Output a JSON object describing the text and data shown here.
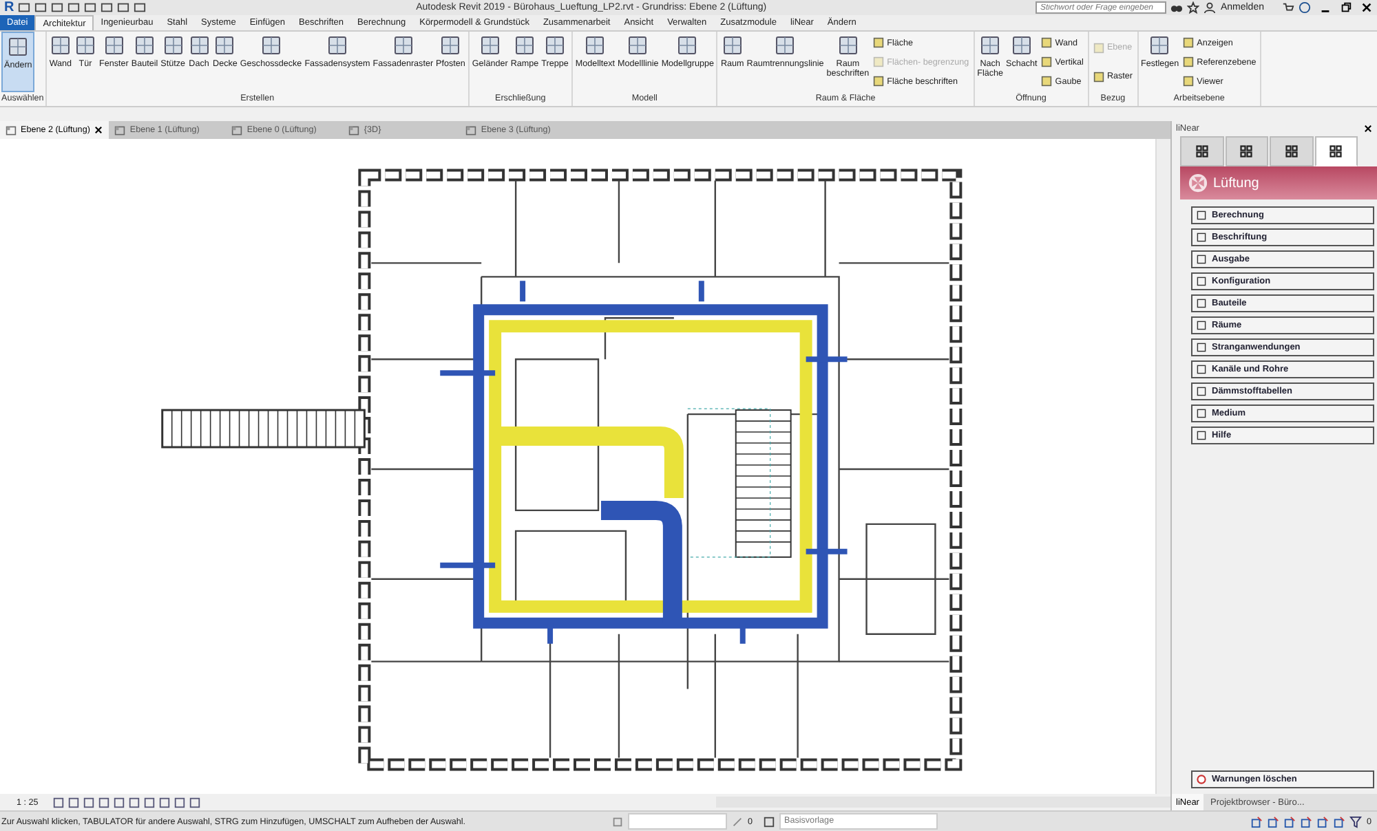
{
  "title_bar": {
    "logo": "R",
    "title": "Autodesk Revit 2019 - Bürohaus_Lueftung_LP2.rvt - Grundriss: Ebene 2 (Lüftung)",
    "search": {
      "placeholder": "Stichwort oder Frage eingeben"
    },
    "user": "Anmelden"
  },
  "menu_tabs": [
    {
      "label": "Datei",
      "kind": "file",
      "selected": false
    },
    {
      "label": "Architektur",
      "kind": "tab",
      "selected": true
    },
    {
      "label": "Ingenieurbau",
      "kind": "tab",
      "selected": false
    },
    {
      "label": "Stahl",
      "kind": "tab",
      "selected": false
    },
    {
      "label": "Systeme",
      "kind": "tab",
      "selected": false
    },
    {
      "label": "Einfügen",
      "kind": "tab",
      "selected": false
    },
    {
      "label": "Beschriften",
      "kind": "tab",
      "selected": false
    },
    {
      "label": "Berechnung",
      "kind": "tab",
      "selected": false
    },
    {
      "label": "Körpermodell & Grundstück",
      "kind": "tab",
      "selected": false
    },
    {
      "label": "Zusammenarbeit",
      "kind": "tab",
      "selected": false
    },
    {
      "label": "Ansicht",
      "kind": "tab",
      "selected": false
    },
    {
      "label": "Verwalten",
      "kind": "tab",
      "selected": false
    },
    {
      "label": "Zusatzmodule",
      "kind": "tab",
      "selected": false
    },
    {
      "label": "liNear",
      "kind": "tab",
      "selected": false
    },
    {
      "label": "Ändern",
      "kind": "tab",
      "selected": false
    }
  ],
  "ribbon_groups": [
    {
      "title": "Auswählen",
      "large": [
        {
          "label": "Ändern",
          "selected": true
        }
      ]
    },
    {
      "title": "Erstellen",
      "large": [
        {
          "label": "Wand",
          "selected": false
        },
        {
          "label": "Tür",
          "selected": false
        },
        {
          "label": "Fenster",
          "selected": false
        },
        {
          "label": "Bauteil",
          "selected": false
        },
        {
          "label": "Stütze",
          "selected": false
        },
        {
          "label": "Dach",
          "selected": false
        },
        {
          "label": "Decke",
          "selected": false
        },
        {
          "label": "Geschossdecke",
          "selected": false
        },
        {
          "label": "Fassadensystem",
          "selected": false
        },
        {
          "label": "Fassadenraster",
          "selected": false
        },
        {
          "label": "Pfosten",
          "selected": false
        }
      ]
    },
    {
      "title": "Erschließung",
      "large": [
        {
          "label": "Geländer",
          "selected": false
        },
        {
          "label": "Rampe",
          "selected": false
        },
        {
          "label": "Treppe",
          "selected": false
        }
      ]
    },
    {
      "title": "Modell",
      "large": [
        {
          "label": "Modelltext",
          "selected": false
        },
        {
          "label": "Modelllinie",
          "selected": false
        },
        {
          "label": "Modellgruppe",
          "selected": false
        }
      ]
    },
    {
      "title": "Raum & Fläche",
      "large": [
        {
          "label": "Raum",
          "selected": false
        },
        {
          "label": "Raumtrennungslinie",
          "selected": false
        },
        {
          "label": "Raum\nbeschriften",
          "selected": false
        }
      ],
      "small": [
        {
          "label": "Fläche",
          "disabled": false
        },
        {
          "label": "Flächen- begrenzung",
          "disabled": true
        },
        {
          "label": "Fläche beschriften",
          "disabled": false
        }
      ]
    },
    {
      "title": "Öffnung",
      "large": [
        {
          "label": "Nach\nFläche",
          "selected": false
        },
        {
          "label": "Schacht",
          "selected": false
        }
      ],
      "small": [
        {
          "label": "Wand",
          "disabled": false
        },
        {
          "label": "Vertikal",
          "disabled": false
        },
        {
          "label": "Gaube",
          "disabled": false
        }
      ]
    },
    {
      "title": "Bezug",
      "small": [
        {
          "label": "Ebene",
          "disabled": true
        },
        {
          "label": "Raster",
          "disabled": false
        }
      ]
    },
    {
      "title": "Arbeitsebene",
      "large": [
        {
          "label": "Festlegen",
          "selected": false
        }
      ],
      "small": [
        {
          "label": "Anzeigen",
          "disabled": false
        },
        {
          "label": "Referenzebene",
          "disabled": false
        },
        {
          "label": "Viewer",
          "disabled": false
        }
      ]
    }
  ],
  "view_tabs": [
    {
      "label": "Ebene 2 (Lüftung)",
      "selected": true
    },
    {
      "label": "Ebene 1 (Lüftung)",
      "selected": false
    },
    {
      "label": "Ebene 0 (Lüftung)",
      "selected": false
    },
    {
      "label": "{3D}",
      "selected": false
    },
    {
      "label": "Ebene 3 (Lüftung)",
      "selected": false
    }
  ],
  "view_control_bar": {
    "scale": "1 : 25"
  },
  "side_panel": {
    "title": "liNear",
    "icon_tabs": [
      {
        "selected": false
      },
      {
        "selected": false
      },
      {
        "selected": false
      },
      {
        "selected": true
      }
    ],
    "header": "Lüftung",
    "buttons": [
      "Berechnung",
      "Beschriftung",
      "Ausgabe",
      "Konfiguration",
      "Bauteile",
      "Räume",
      "Stranganwendungen",
      "Kanäle und Rohre",
      "Dämmstofftabellen",
      "Medium",
      "Hilfe"
    ],
    "warnings_button": "Warnungen löschen",
    "bottom_tabs": [
      {
        "label": "liNear",
        "selected": true
      },
      {
        "label": "Projektbrowser - Büro...",
        "selected": false
      }
    ]
  },
  "status_bar": {
    "message": "Zur Auswahl klicken, TABULATOR für andere Auswahl, STRG zum Hinzufügen, UMSCHALT zum Aufheben der Auswahl.",
    "workset_count": "0",
    "view_template": "Basisvorlage",
    "filter_count": "0"
  }
}
